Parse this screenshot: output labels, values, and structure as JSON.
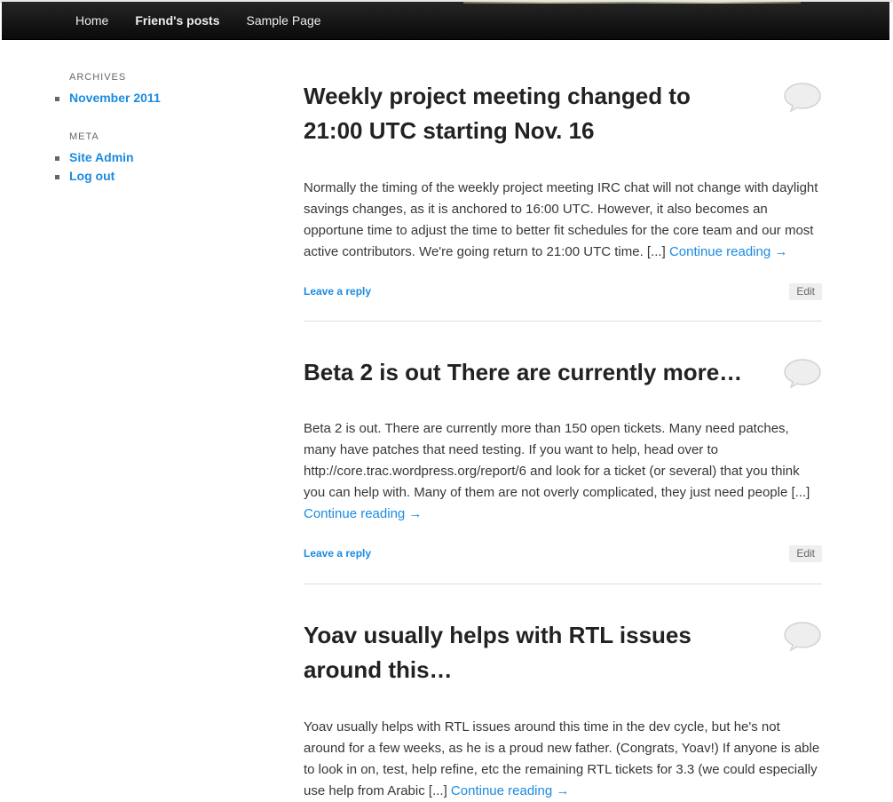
{
  "nav": {
    "items": [
      {
        "label": "Home"
      },
      {
        "label": "Friend's posts"
      },
      {
        "label": "Sample Page"
      }
    ]
  },
  "sidebar": {
    "archives": {
      "title": "ARCHIVES",
      "items": [
        {
          "label": "November 2011"
        }
      ]
    },
    "meta": {
      "title": "META",
      "items": [
        {
          "label": "Site Admin"
        },
        {
          "label": "Log out"
        }
      ]
    }
  },
  "posts": [
    {
      "title": "Weekly project meeting changed to 21:00 UTC starting Nov. 16",
      "excerpt": "Normally the timing of the weekly project meeting IRC chat will not change with daylight savings changes, as it is anchored to 16:00 UTC. However, it also becomes an opportune time to adjust the time to better fit schedules for the core team and our most active contributors. We're going return to 21:00 UTC time. [...] ",
      "continue": "Continue reading →",
      "reply": "Leave a reply",
      "edit": "Edit"
    },
    {
      "title": "Beta 2 is out There are currently more…",
      "excerpt": "Beta 2 is out. There are currently more than 150 open tickets. Many need patches, many have patches that need testing. If you want to help, head over to http://core.trac.wordpress.org/report/6 and look for a ticket (or several) that you think you can help with. Many of them are not overly complicated, they just need people [...] ",
      "continue": "Continue reading →",
      "reply": "Leave a reply",
      "edit": "Edit"
    },
    {
      "title": "Yoav usually helps with RTL issues around this…",
      "excerpt": "Yoav usually helps with RTL issues around this time in the dev cycle, but he's not around for a few weeks, as he is a proud new father. (Congrats, Yoav!) If anyone is able to look in on, test, help refine, etc the remaining RTL tickets for 3.3 (we could especially use help from Arabic [...] ",
      "continue": "Continue reading →"
    }
  ]
}
